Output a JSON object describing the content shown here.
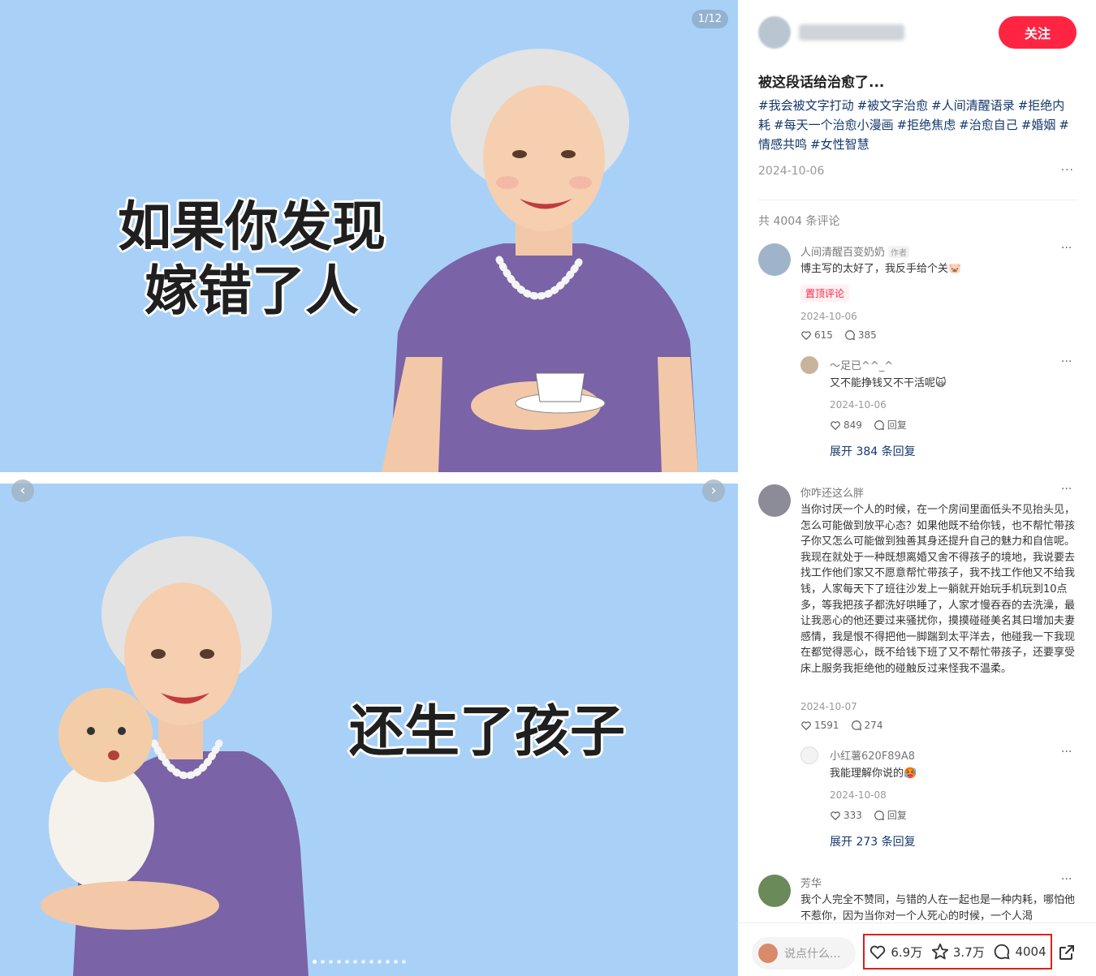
{
  "media": {
    "counter": "1/12",
    "caption1_line1": "如果你发现",
    "caption1_line2": "嫁错了人",
    "caption2": "还生了孩子",
    "dots_total": 12,
    "dots_active": 1
  },
  "author": {
    "follow_label": "关注"
  },
  "note": {
    "title": "被这段话给治愈了...",
    "tags": [
      "#我会被文字打动",
      "#被文字治愈",
      "#人间清醒语录",
      "#拒绝内耗",
      "#每天一个治愈小漫画",
      "#拒绝焦虑",
      "#治愈自己",
      "#婚姻",
      "#情感共鸣",
      "#女性智慧"
    ],
    "date": "2024-10-06",
    "more": "···"
  },
  "comments_header": "共 4004 条评论",
  "comments": {
    "c1": {
      "name": "人间清醒百变奶奶",
      "author_tag": "作者",
      "text": "博主写的太好了，我反手给个关🐷",
      "pin": "置顶评论",
      "date": "2024-10-06",
      "likes": "615",
      "replies": "385"
    },
    "r1": {
      "name": "～足已^^_^",
      "text": "又不能挣钱又不干活呢🙀",
      "date": "2024-10-06",
      "likes": "849",
      "reply_label": "回复"
    },
    "expand1": "展开 384 条回复",
    "c2": {
      "name": "你咋还这么胖",
      "text": "当你讨厌一个人的时候，在一个房间里面低头不见抬头见，怎么可能做到放平心态？如果他既不给你钱，也不帮忙带孩子你又怎么可能做到独善其身还提升自己的魅力和自信呢。我现在就处于一种既想离婚又舍不得孩子的境地，我说要去找工作他们家又不愿意帮忙带孩子，我不找工作他又不给我钱，人家每天下了班往沙发上一躺就开始玩手机玩到10点多，等我把孩子都洗好哄睡了，人家才慢吞吞的去洗澡，最让我恶心的他还要过来骚扰你，摸摸碰碰美名其曰增加夫妻感情，我是恨不得把他一脚踹到太平洋去，他碰我一下我现在都觉得恶心，既不给钱下班了又不帮忙带孩子，还要享受床上服务我拒绝他的碰触反过来怪我不温柔。",
      "date": "2024-10-07",
      "likes": "1591",
      "replies": "274"
    },
    "r2": {
      "name": "小红薯620F89A8",
      "text": "我能理解你说的🥵",
      "date": "2024-10-08",
      "likes": "333",
      "reply_label": "回复"
    },
    "expand2": "展开 273 条回复",
    "c3": {
      "name": "芳华",
      "text": "我个人完全不赞同，与错的人在一起也是一种内耗，哪怕他不惹你，因为当你对一个人死心的时候，一个人渴"
    }
  },
  "bottom": {
    "input_placeholder": "说点什么...",
    "likes": "6.9万",
    "collects": "3.7万",
    "comments": "4004"
  },
  "colors": {
    "brand": "#ff2442",
    "tag": "#13386c",
    "media_bg": "#a9d1f7",
    "dress": "#7a63a6"
  }
}
